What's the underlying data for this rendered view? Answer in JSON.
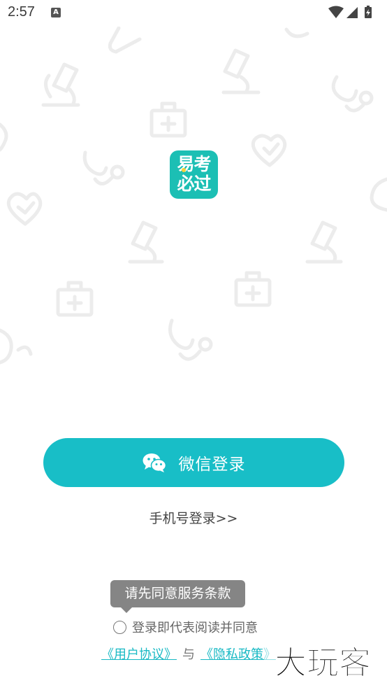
{
  "status_bar": {
    "time": "2:57",
    "notification_letter": "A"
  },
  "logo": {
    "text_line1": "易考",
    "text_line2": "必过",
    "color": "#1cbfb4"
  },
  "login": {
    "wechat_label": "微信登录",
    "phone_link": "手机号登录>>",
    "accent_color": "#18bec7"
  },
  "agreement": {
    "tooltip": "请先同意服务条款",
    "consent_text": "登录即代表阅读并同意",
    "user_agreement": "《用户协议》",
    "separator": "与",
    "privacy_policy": "《隐私政策》"
  },
  "watermark": {
    "text": "大玩客"
  }
}
